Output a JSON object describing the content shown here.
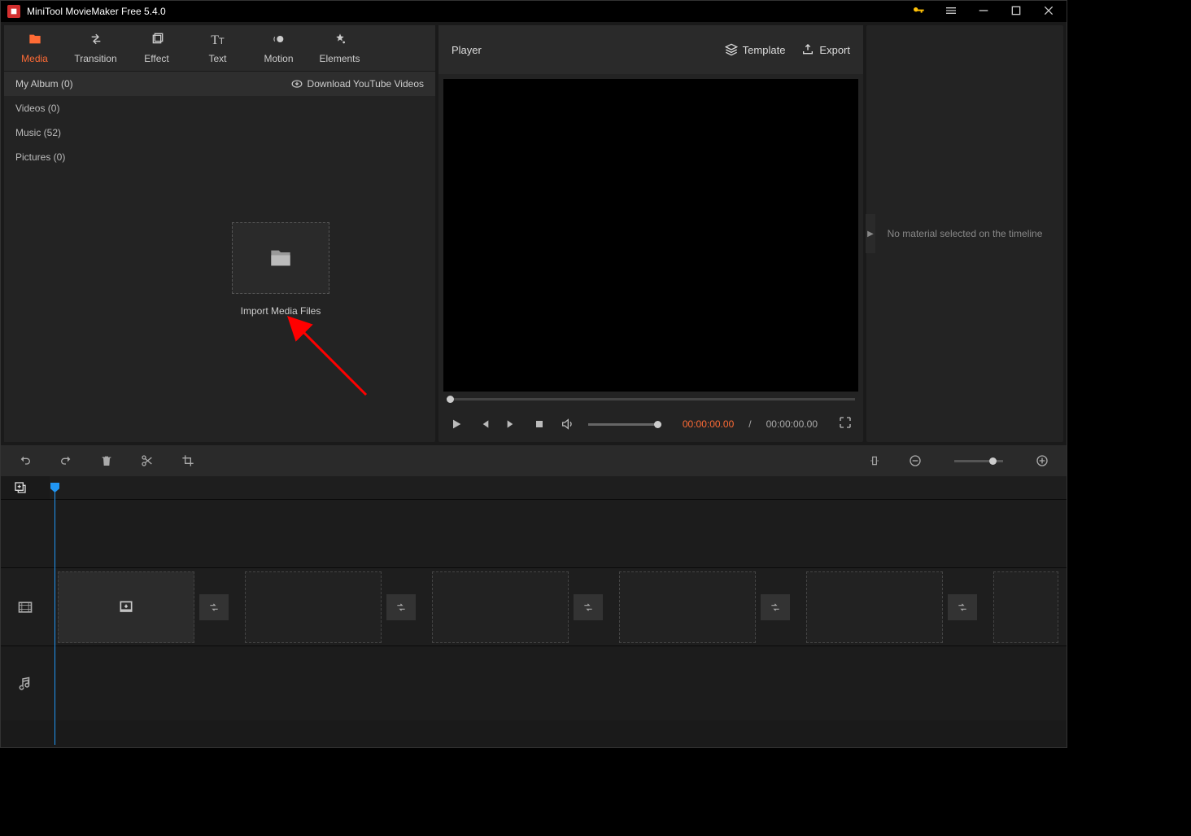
{
  "titlebar": {
    "title": "MiniTool MovieMaker Free 5.4.0"
  },
  "tabs": [
    {
      "label": "Media",
      "icon": "folder"
    },
    {
      "label": "Transition",
      "icon": "transition"
    },
    {
      "label": "Effect",
      "icon": "effect"
    },
    {
      "label": "Text",
      "icon": "text"
    },
    {
      "label": "Motion",
      "icon": "motion"
    },
    {
      "label": "Elements",
      "icon": "elements"
    }
  ],
  "media": {
    "album_label": "My Album (0)",
    "download_label": "Download YouTube Videos",
    "sidebar": [
      {
        "label": "Videos (0)"
      },
      {
        "label": "Music (52)"
      },
      {
        "label": "Pictures (0)"
      }
    ],
    "import_label": "Import Media Files"
  },
  "player": {
    "title": "Player",
    "template_label": "Template",
    "export_label": "Export",
    "time_current": "00:00:00.00",
    "time_sep": "/",
    "time_total": "00:00:00.00"
  },
  "right_panel": {
    "empty_text": "No material selected on the timeline"
  }
}
